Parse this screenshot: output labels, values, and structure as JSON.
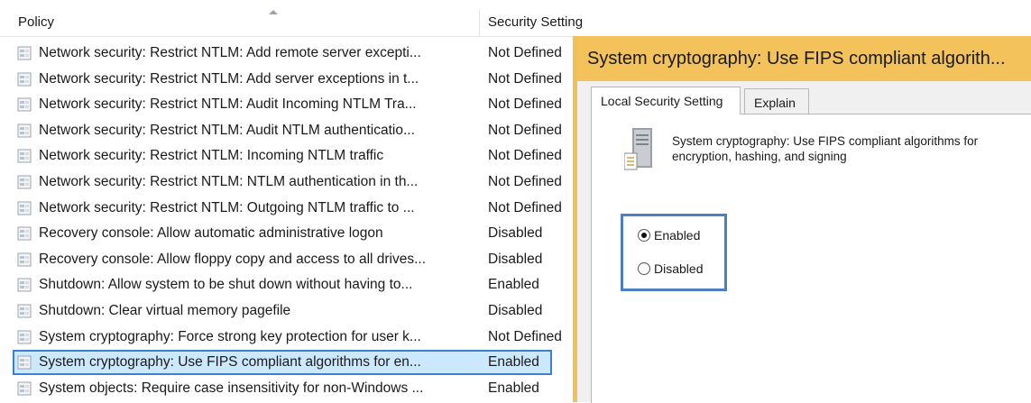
{
  "list": {
    "headers": {
      "policy": "Policy",
      "security_setting": "Security Setting"
    },
    "rows": [
      {
        "name": "Network security: Restrict NTLM: Add remote server excepti...",
        "setting": "Not Defined",
        "selected": false
      },
      {
        "name": "Network security: Restrict NTLM: Add server exceptions in t...",
        "setting": "Not Defined",
        "selected": false
      },
      {
        "name": "Network security: Restrict NTLM: Audit Incoming NTLM Tra...",
        "setting": "Not Defined",
        "selected": false
      },
      {
        "name": "Network security: Restrict NTLM: Audit NTLM authenticatio...",
        "setting": "Not Defined",
        "selected": false
      },
      {
        "name": "Network security: Restrict NTLM: Incoming NTLM traffic",
        "setting": "Not Defined",
        "selected": false
      },
      {
        "name": "Network security: Restrict NTLM: NTLM authentication in th...",
        "setting": "Not Defined",
        "selected": false
      },
      {
        "name": "Network security: Restrict NTLM: Outgoing NTLM traffic to ...",
        "setting": "Not Defined",
        "selected": false
      },
      {
        "name": "Recovery console: Allow automatic administrative logon",
        "setting": "Disabled",
        "selected": false
      },
      {
        "name": "Recovery console: Allow floppy copy and access to all drives...",
        "setting": "Disabled",
        "selected": false
      },
      {
        "name": "Shutdown: Allow system to be shut down without having to...",
        "setting": "Enabled",
        "selected": false
      },
      {
        "name": "Shutdown: Clear virtual memory pagefile",
        "setting": "Disabled",
        "selected": false
      },
      {
        "name": "System cryptography: Force strong key protection for user k...",
        "setting": "Not Defined",
        "selected": false
      },
      {
        "name": "System cryptography: Use FIPS compliant algorithms for en...",
        "setting": "Enabled",
        "selected": true
      },
      {
        "name": "System objects: Require case insensitivity for non-Windows ...",
        "setting": "Enabled",
        "selected": false
      }
    ],
    "row_icon": "policy-item-icon"
  },
  "dialog": {
    "title": "System cryptography: Use FIPS compliant algorith...",
    "tabs": [
      {
        "label": "Local Security Setting",
        "active": true
      },
      {
        "label": "Explain",
        "active": false
      }
    ],
    "description": "System cryptography: Use FIPS compliant algorithms for encryption, hashing, and signing",
    "icon": "server-document-icon",
    "options": [
      {
        "label": "Enabled",
        "checked": true
      },
      {
        "label": "Disabled",
        "checked": false
      }
    ]
  },
  "colors": {
    "title_bar": "#f3c25a",
    "selection_fill": "#cce8ff",
    "highlight_border": "#3d7fd0"
  }
}
